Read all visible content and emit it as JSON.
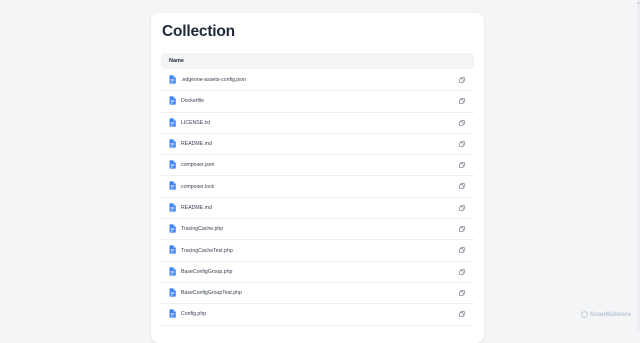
{
  "page": {
    "title": "Collection"
  },
  "table": {
    "column_name": "Name",
    "rows": [
      {
        "name": ".edgeone-assets-config.json"
      },
      {
        "name": "Dockerfile"
      },
      {
        "name": "LICENSE.txt"
      },
      {
        "name": "README.md"
      },
      {
        "name": "composer.json"
      },
      {
        "name": "composer.lock"
      },
      {
        "name": "README.md"
      },
      {
        "name": "TracingCache.php"
      },
      {
        "name": "TracingCacheTest.php"
      },
      {
        "name": "BaseConfigGroup.php"
      },
      {
        "name": "BaseConfigGroupTest.php"
      },
      {
        "name": "Config.php"
      }
    ]
  },
  "watermark": {
    "text": "ScanMalware"
  },
  "colors": {
    "file_icon": "#3b82f6",
    "background": "#f4f5f7",
    "card": "#ffffff"
  },
  "icons": {
    "file": "file-icon",
    "copy": "copy-icon",
    "watermark": "scanmalware-logo-icon"
  }
}
